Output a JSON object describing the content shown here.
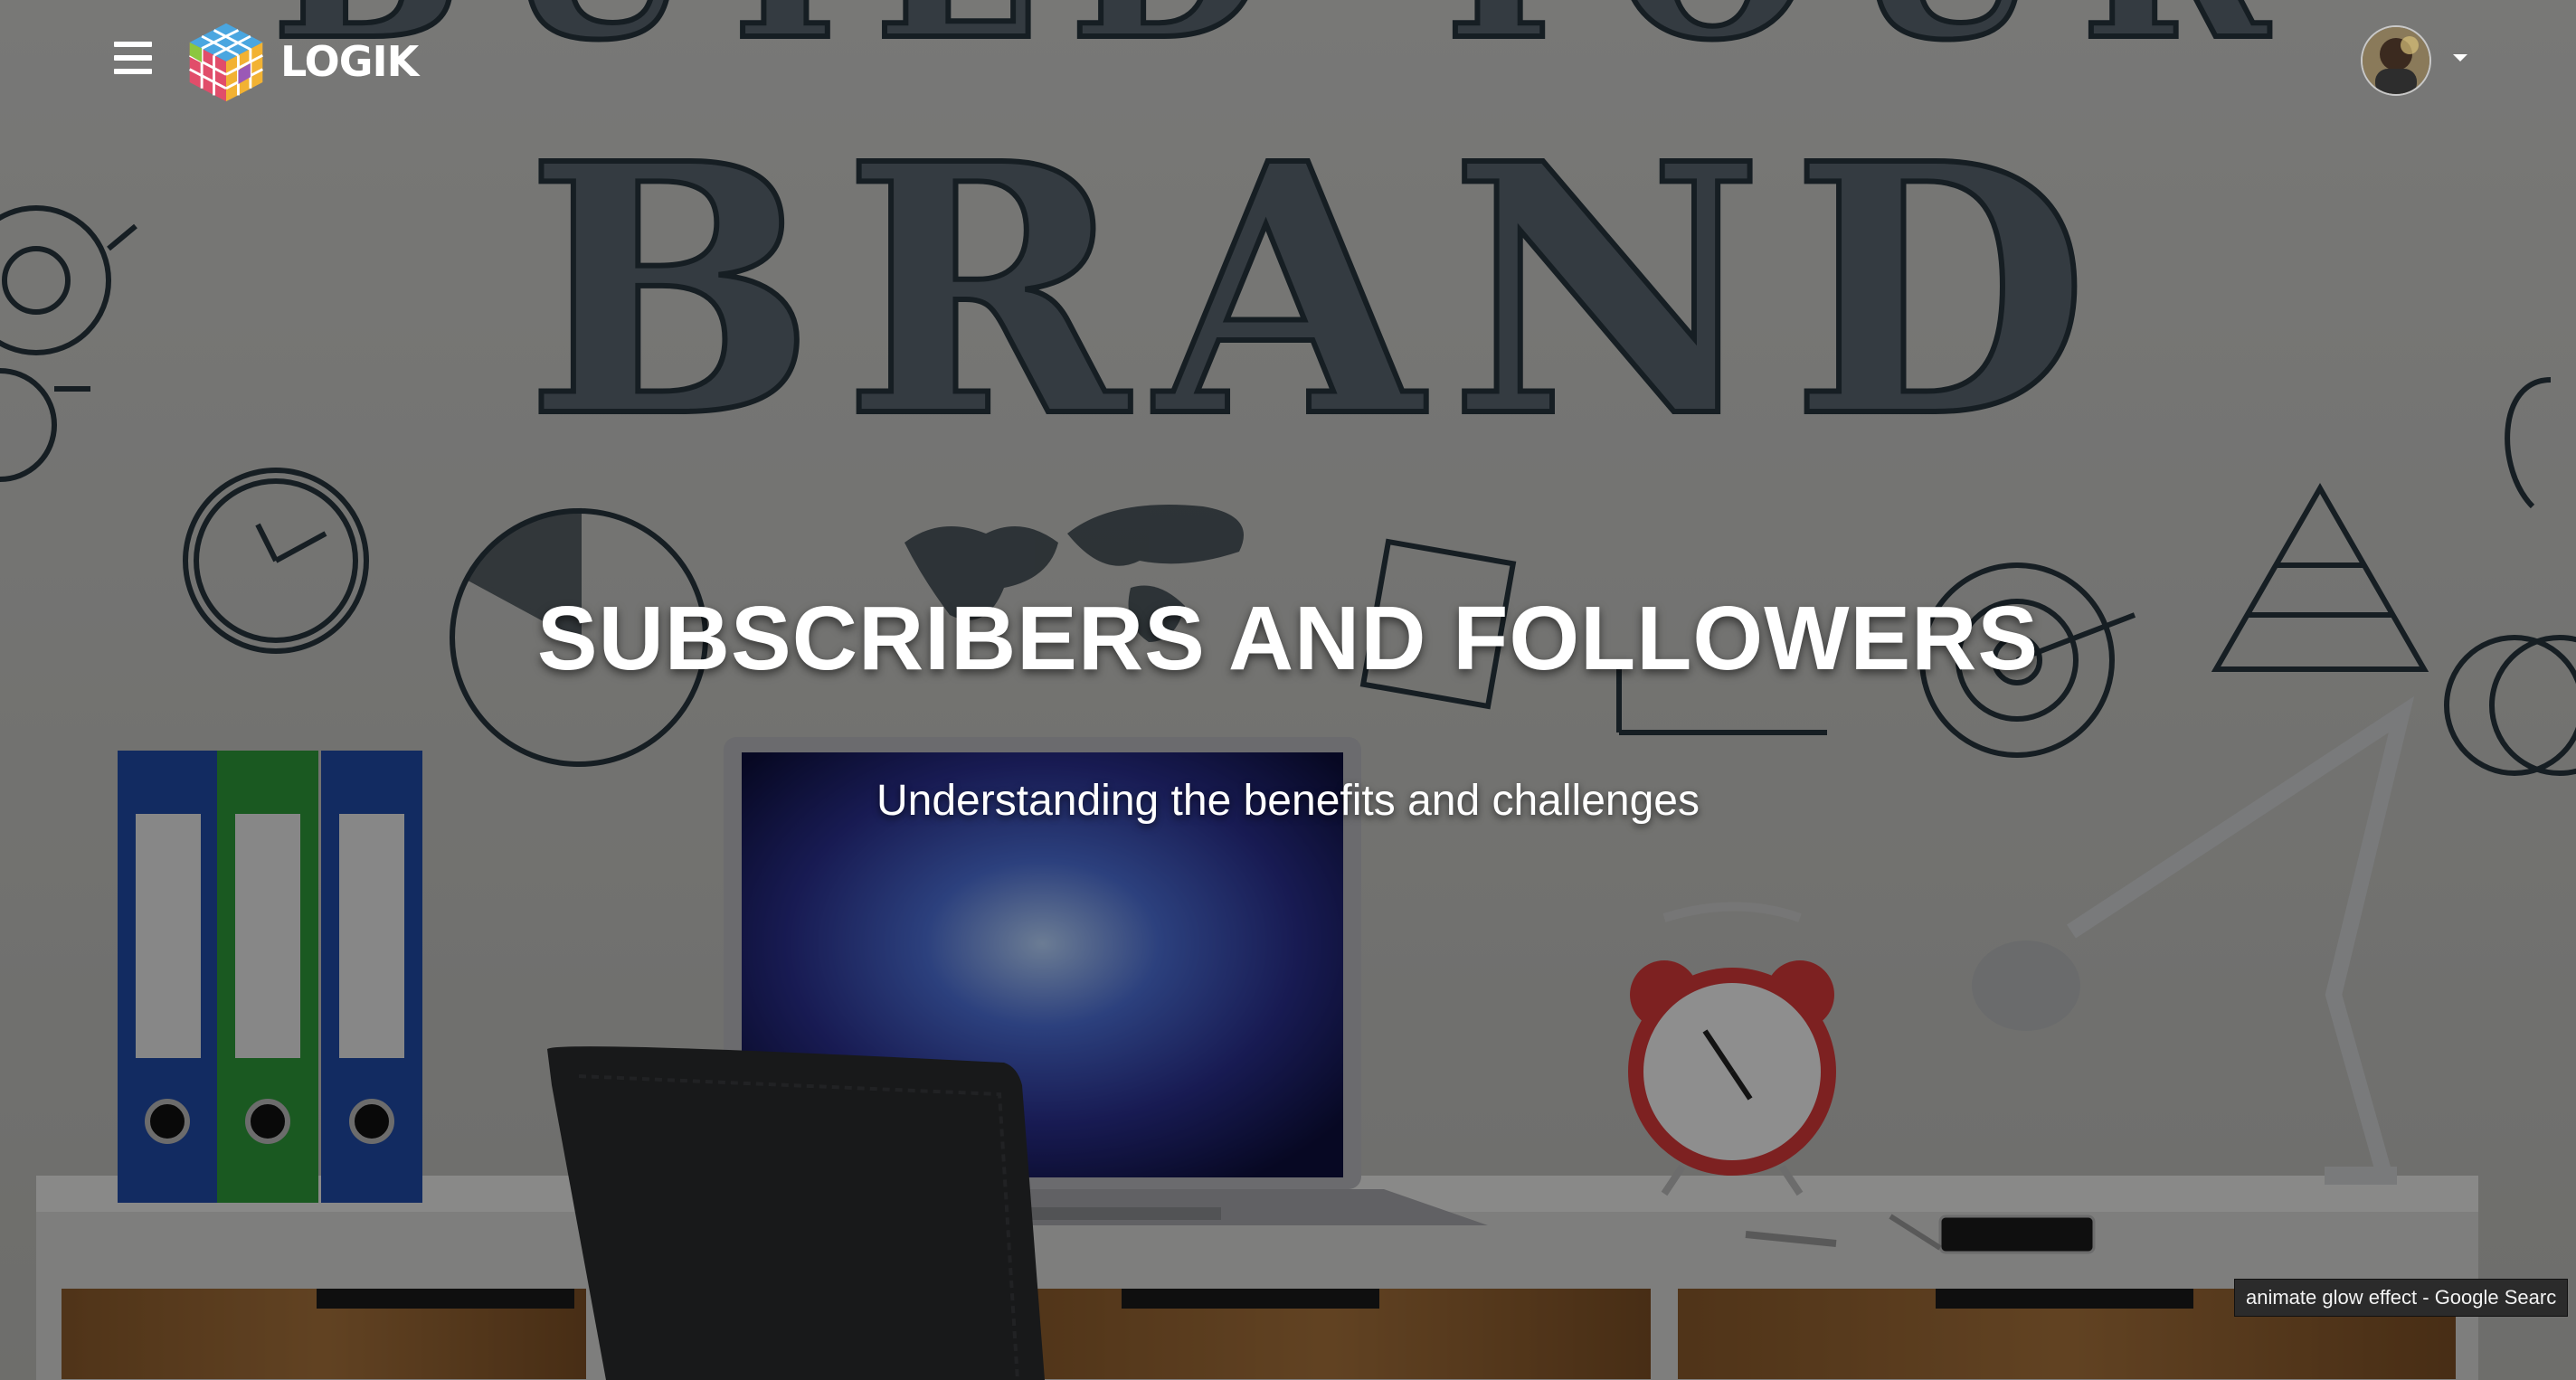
{
  "app": {
    "brand_name": "LOGIK"
  },
  "nav": {
    "menu_icon": "hamburger-menu-icon",
    "logo_icon": "rubiks-cube-logo-icon",
    "avatar_icon": "user-avatar",
    "dropdown_icon": "caret-down-icon"
  },
  "hero": {
    "background_text": "BUILD YOUR BRAND",
    "title": "SUBSCRIBERS AND FOLLOWERS",
    "subtitle": "Understanding the benefits and challenges",
    "overlay_color": "#000000"
  },
  "status_bar": {
    "link_preview": "animate glow effect - Google Searc"
  },
  "colors": {
    "text": "#ffffff",
    "folder_blue": "#1f4aa8",
    "folder_green": "#2e9a3a",
    "clock_red": "#d83a3a",
    "sketch_ink": "#27343d"
  }
}
